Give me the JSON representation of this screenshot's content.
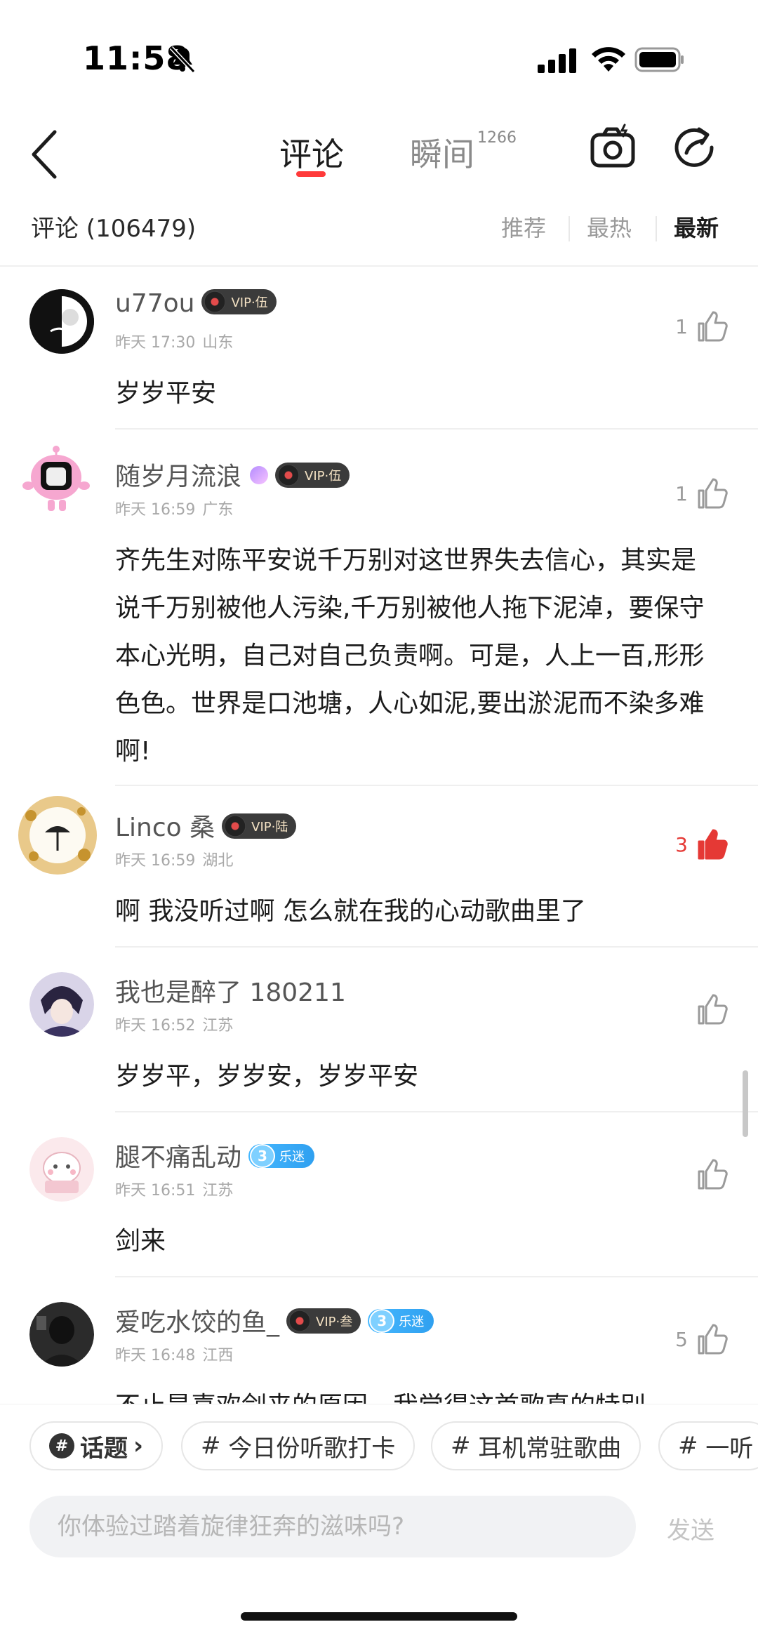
{
  "status_bar": {
    "time": "11:58"
  },
  "nav": {
    "tabs": [
      {
        "label": "评论"
      },
      {
        "label": "瞬间",
        "count": "1266"
      }
    ]
  },
  "sort_bar": {
    "title": "评论 (106479)",
    "options": [
      "推荐",
      "最热",
      "最新"
    ],
    "selected": "最新"
  },
  "comments": [
    {
      "username": "u77ou",
      "vip": "VIP·伍",
      "date": "昨天 17:30",
      "location": "山东",
      "likes": "1",
      "liked": false,
      "text": "岁岁平安"
    },
    {
      "username": "随岁月流浪",
      "vip": "VIP·伍",
      "date": "昨天 16:59",
      "location": "广东",
      "likes": "1",
      "liked": false,
      "text": "齐先生对陈平安说千万别对这世界失去信心，其实是说千万别被他人污染,千万别被他人拖下泥淖，要保守本心光明，自己对自己负责啊。可是，人上一百,形形色色。世界是口池塘，人心如泥,要出淤泥而不染多难啊!"
    },
    {
      "username": "Linco 桑",
      "vip": "VIP·陆",
      "date": "昨天 16:59",
      "location": "湖北",
      "likes": "3",
      "liked": true,
      "text": "啊  我没听过啊  怎么就在我的心动歌曲里了"
    },
    {
      "username": "我也是醉了 180211",
      "date": "昨天 16:52",
      "location": "江苏",
      "likes": "",
      "liked": false,
      "text": "岁岁平，岁岁安，岁岁平安"
    },
    {
      "username": "腿不痛乱动",
      "fan_level": "3",
      "fan_label": "乐迷",
      "date": "昨天 16:51",
      "location": "江苏",
      "likes": "",
      "liked": false,
      "text": "剑来"
    },
    {
      "username": "爱吃水饺的鱼_",
      "vip": "VIP·叁",
      "fan_level": "3",
      "fan_label": "乐迷",
      "date": "昨天 16:48",
      "location": "江西",
      "likes": "5",
      "liked": false,
      "text": "不止是喜欢剑来的原因，我觉得这首歌真的特别"
    }
  ],
  "topics": {
    "button_label": "话题",
    "chips": [
      "今日份听歌打卡",
      "耳机常驻歌曲",
      "一听"
    ]
  },
  "input": {
    "placeholder": "你体验过踏着旋律狂奔的滋味吗?",
    "send_label": "发送"
  },
  "colors": {
    "accent": "#ff3a3a",
    "liked": "#e53935",
    "vip_bg": "#3b3b3b",
    "fan_badge": "#2fa0f0"
  }
}
